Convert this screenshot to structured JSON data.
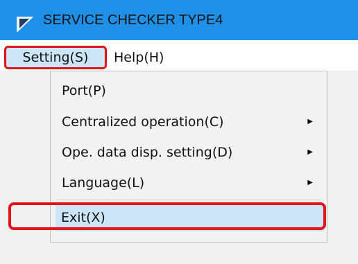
{
  "window": {
    "title": "SERVICE CHECKER TYPE4",
    "title_bar_color": "#1e90e8",
    "highlight_color": "#e11515"
  },
  "menubar": {
    "items": [
      {
        "label": "Setting(S)",
        "state": "open"
      },
      {
        "label": "Help(H)"
      }
    ]
  },
  "dropdown": {
    "items": [
      {
        "label": "Port(P)",
        "has_submenu": false
      },
      {
        "label": "Centralized operation(C)",
        "has_submenu": true
      },
      {
        "label": "Ope. data disp. setting(D)",
        "has_submenu": true
      },
      {
        "label": "Language(L)",
        "has_submenu": true
      },
      {
        "label": "Exit(X)",
        "has_submenu": false,
        "hovered": true
      }
    ],
    "submenu_arrow_icon": "triangle-right-icon"
  }
}
